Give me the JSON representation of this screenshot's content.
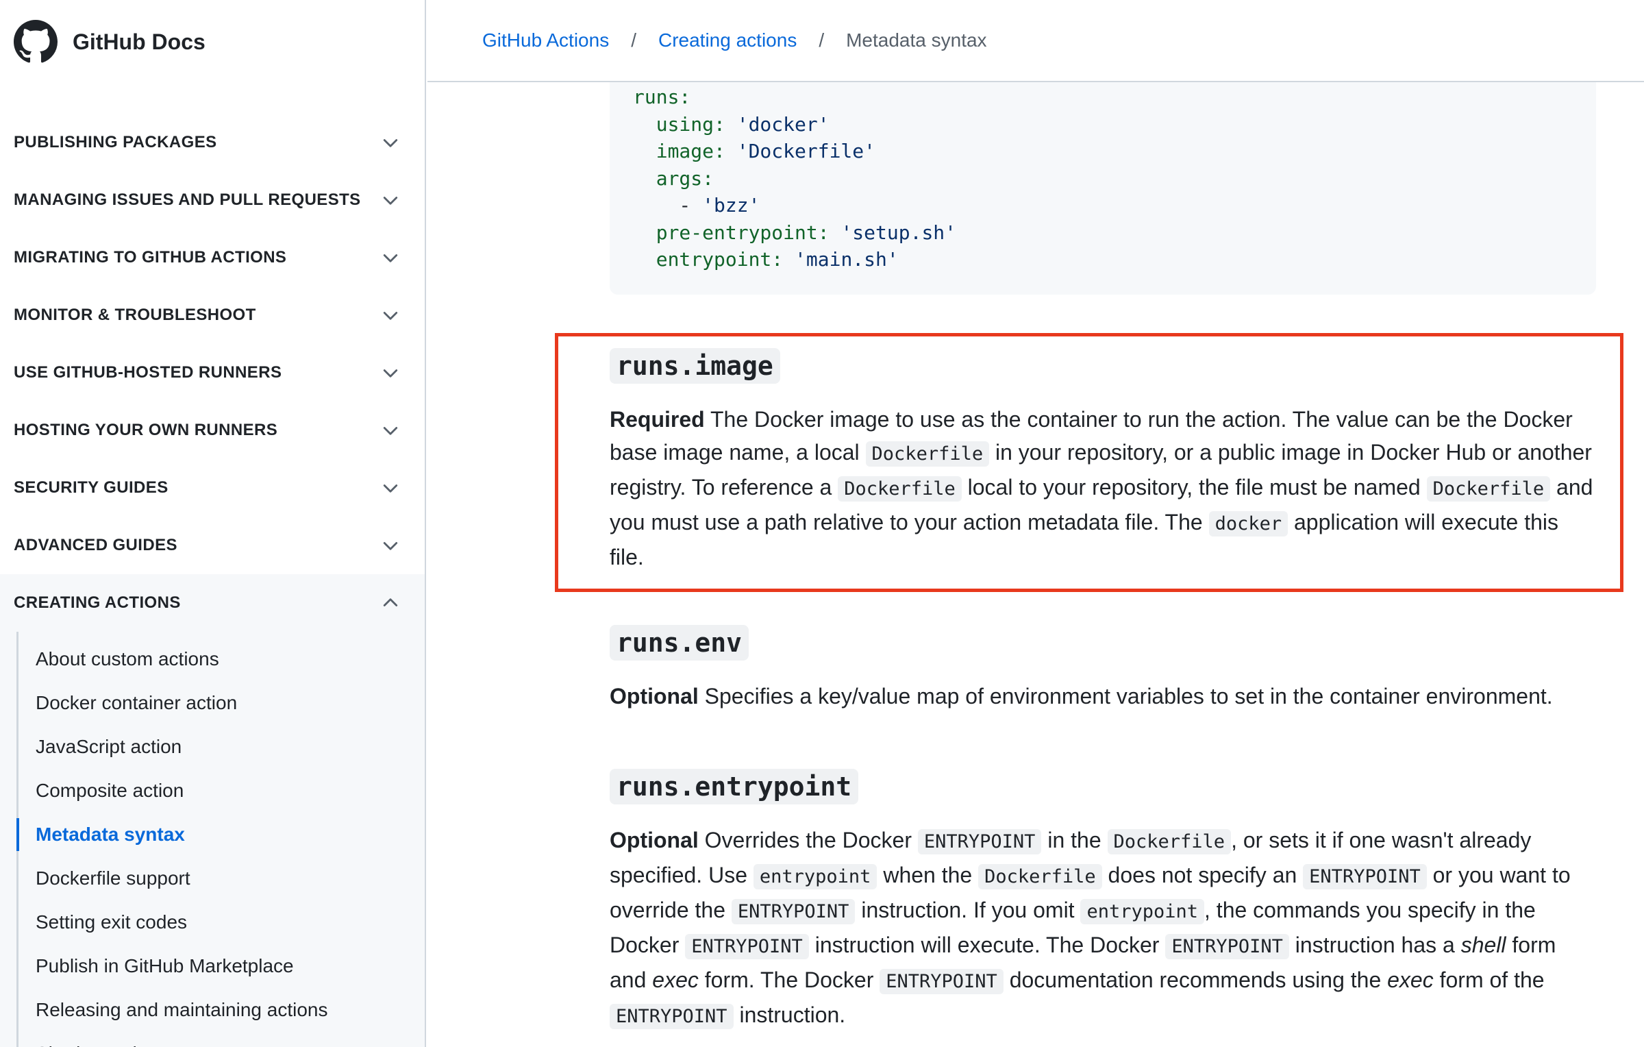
{
  "brand": {
    "name": "GitHub Docs",
    "logo_icon": "github-octocat-icon"
  },
  "sidebar": {
    "items": [
      {
        "label": "PUBLISHING PACKAGES"
      },
      {
        "label": "MANAGING ISSUES AND PULL REQUESTS"
      },
      {
        "label": "MIGRATING TO GITHUB ACTIONS"
      },
      {
        "label": "MONITOR & TROUBLESHOOT"
      },
      {
        "label": "USE GITHUB-HOSTED RUNNERS"
      },
      {
        "label": "HOSTING YOUR OWN RUNNERS"
      },
      {
        "label": "SECURITY GUIDES"
      },
      {
        "label": "ADVANCED GUIDES"
      }
    ],
    "open_item": {
      "label": "CREATING ACTIONS",
      "children": [
        "About custom actions",
        "Docker container action",
        "JavaScript action",
        "Composite action",
        "Metadata syntax",
        "Dockerfile support",
        "Setting exit codes",
        "Publish in GitHub Marketplace",
        "Releasing and maintaining actions",
        "Sharing actions"
      ],
      "active_child": "Metadata syntax"
    }
  },
  "breadcrumb": {
    "items": [
      "GitHub Actions",
      "Creating actions",
      "Metadata syntax"
    ],
    "separator": "/"
  },
  "code": {
    "lines": [
      [
        "runs:"
      ],
      [
        "  using: ",
        "'docker'"
      ],
      [
        "  image: ",
        "'Dockerfile'"
      ],
      [
        "  args:"
      ],
      [
        "    - ",
        "'bzz'"
      ],
      [
        "  pre-entrypoint: ",
        "'setup.sh'"
      ],
      [
        "  entrypoint: ",
        "'main.sh'"
      ]
    ]
  },
  "sections": {
    "image": {
      "heading": "runs.image",
      "req": "Required",
      "t1": " The Docker image to use as the container to run the action. The value can be the Docker base image name, a local ",
      "c1": "Dockerfile",
      "t2": " in your repository, or a public image in Docker Hub or another registry. To reference a ",
      "c2": "Dockerfile",
      "t3": " local to your repository, the file must be named ",
      "c3": "Dockerfile",
      "t4": " and you must use a path relative to your action metadata file. The ",
      "c4": "docker",
      "t5": " application will execute this file."
    },
    "env": {
      "heading": "runs.env",
      "req": "Optional",
      "t1": " Specifies a key/value map of environment variables to set in the container environment."
    },
    "entrypoint": {
      "heading": "runs.entrypoint",
      "req": "Optional",
      "t1": " Overrides the Docker ",
      "c1": "ENTRYPOINT",
      "t2": " in the ",
      "c2": "Dockerfile",
      "t3": ", or sets it if one wasn't already specified. Use ",
      "c3": "entrypoint",
      "t4": " when the ",
      "c4": "Dockerfile",
      "t5": " does not specify an ",
      "c5": "ENTRYPOINT",
      "t6": " or you want to override the ",
      "c6": "ENTRYPOINT",
      "t7": " instruction. If you omit ",
      "c7": "entrypoint",
      "t8": ", the commands you specify in the Docker ",
      "c8": "ENTRYPOINT",
      "t9": " instruction will execute. The Docker ",
      "c9": "ENTRYPOINT",
      "t10": " instruction has a ",
      "i1": "shell",
      "t11": " form and ",
      "i2": "exec",
      "t12": " form. The Docker ",
      "c10": "ENTRYPOINT",
      "t13": " documentation recommends using the ",
      "i3": "exec",
      "t14": " form of the ",
      "c11": "ENTRYPOINT",
      "t15": " instruction."
    }
  },
  "colors": {
    "link": "#0969da",
    "highlight": "#e8391d",
    "code_bg": "#f6f8fa"
  }
}
